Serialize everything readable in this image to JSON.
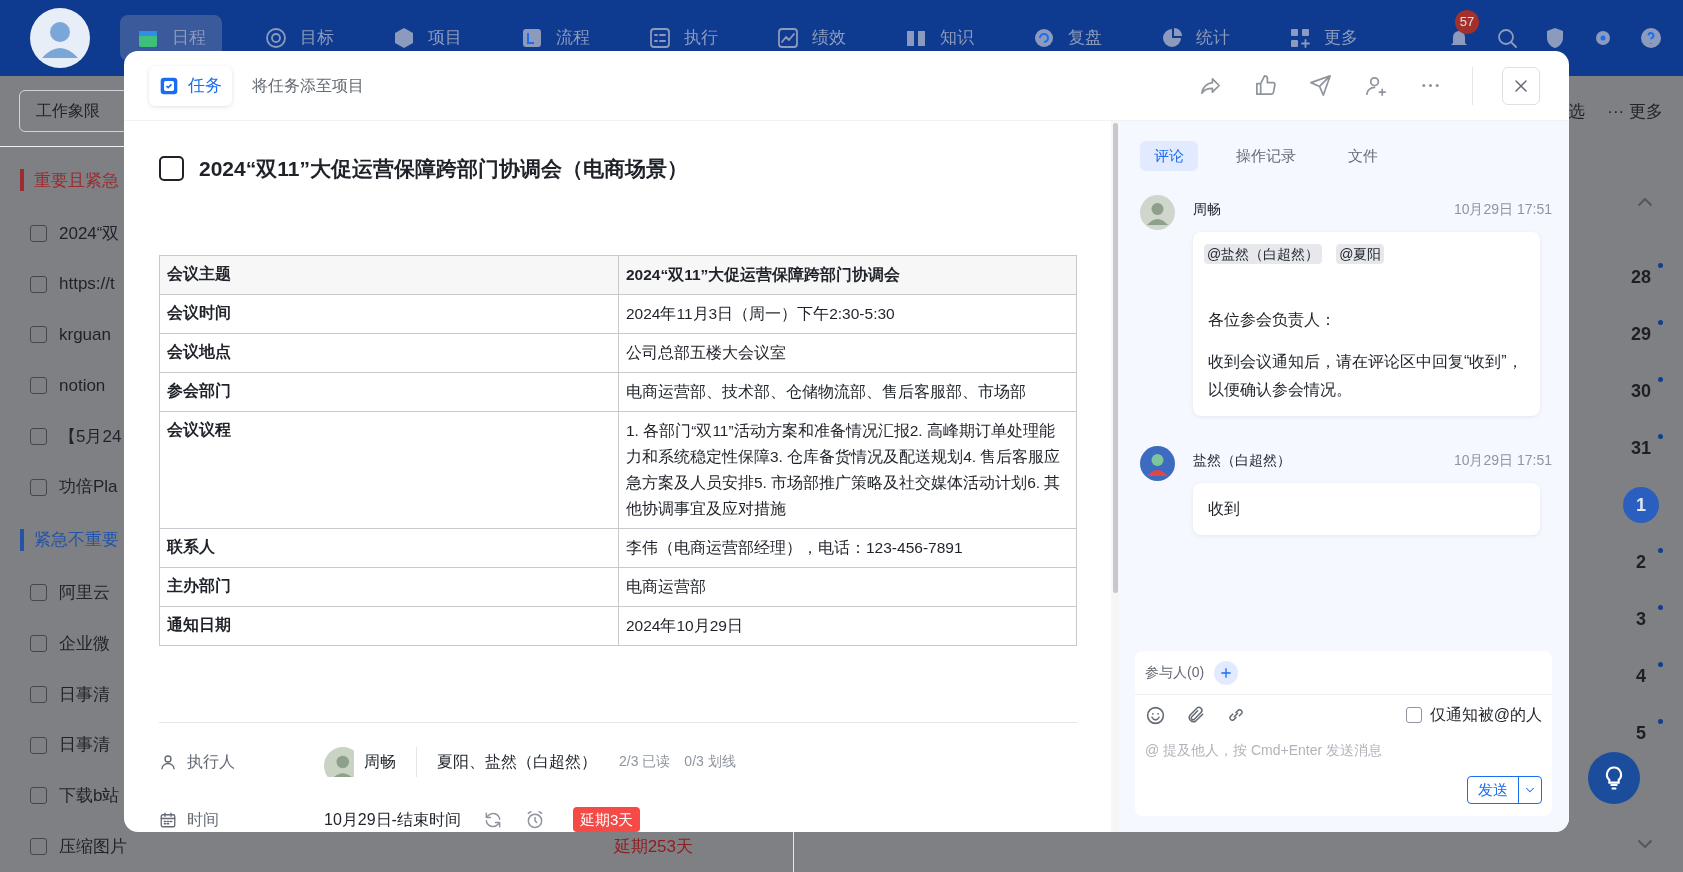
{
  "nav": {
    "items": [
      {
        "label": "日程",
        "selected": true
      },
      {
        "label": "目标",
        "selected": false
      },
      {
        "label": "项目",
        "selected": false
      },
      {
        "label": "流程",
        "selected": false
      },
      {
        "label": "执行",
        "selected": false
      },
      {
        "label": "绩效",
        "selected": false
      },
      {
        "label": "知识",
        "selected": false
      },
      {
        "label": "复盘",
        "selected": false
      },
      {
        "label": "统计",
        "selected": false
      },
      {
        "label": "更多",
        "selected": false
      }
    ],
    "notification_count": "57"
  },
  "toolbar": {
    "view_select": "工作象限",
    "filter_label": "选",
    "more": "··· 更多"
  },
  "quadrants": [
    {
      "title": "重要且紧急",
      "color": "#9b2c31",
      "tasks": [
        {
          "title": "2024“双",
          "checked": false
        },
        {
          "title": "https://t",
          "checked": false
        },
        {
          "title": "krguan",
          "checked": false
        },
        {
          "title": "notion",
          "checked": false
        },
        {
          "title": "【5月24",
          "checked": false
        },
        {
          "title": "功倍Pla",
          "checked": false
        }
      ]
    },
    {
      "title": "紧急不重要",
      "color": "#2453a8",
      "tasks": [
        {
          "title": "阿里云",
          "checked": false
        },
        {
          "title": "企业微",
          "checked": false
        },
        {
          "title": "日事清",
          "checked": false
        },
        {
          "title": "日事清",
          "checked": false
        },
        {
          "title": "下载b站",
          "checked": false
        },
        {
          "title": "压缩图片",
          "checked": false,
          "overdue": "延期253天"
        }
      ]
    }
  ],
  "calendar": {
    "days": [
      {
        "label": "28",
        "dot": true,
        "selected": false
      },
      {
        "label": "29",
        "dot": true,
        "selected": false
      },
      {
        "label": "30",
        "dot": true,
        "selected": false
      },
      {
        "label": "31",
        "dot": true,
        "selected": false
      },
      {
        "label": "1",
        "dot": false,
        "selected": true
      },
      {
        "label": "2",
        "dot": true,
        "selected": false
      },
      {
        "label": "3",
        "dot": true,
        "selected": false
      },
      {
        "label": "4",
        "dot": true,
        "selected": false
      },
      {
        "label": "5",
        "dot": true,
        "selected": false
      }
    ]
  },
  "task_dialog": {
    "type_chip": "任务",
    "add_to_project": "将任务添至项目",
    "title": "2024“双11”大促运营保障跨部门协调会（电商场景）",
    "completed": false,
    "table": {
      "rows": [
        {
          "kind": "header",
          "label": "会议主题",
          "value": "2024“双11”大促运营保障跨部门协调会"
        },
        {
          "kind": "data",
          "label": "会议时间",
          "value": "2024年11月3日（周一）下午2:30-5:30"
        },
        {
          "kind": "data",
          "label": "会议地点",
          "value": "公司总部五楼大会议室"
        },
        {
          "kind": "data",
          "label": "参会部门",
          "value": "电商运营部、技术部、仓储物流部、售后客服部、市场部"
        },
        {
          "kind": "data",
          "label": "会议议程",
          "value": "1. 各部门“双11”活动方案和准备情况汇报2. 高峰期订单处理能力和系统稳定性保障3. 仓库备货情况及配送规划4. 售后客服应急方案及人员安排5. 市场部推广策略及社交媒体活动计划6. 其他协调事宜及应对措施"
        },
        {
          "kind": "data",
          "label": "联系人",
          "value": "李伟（电商运营部经理），电话：123-456-7891"
        },
        {
          "kind": "data",
          "label": "主办部门",
          "value": "电商运营部"
        },
        {
          "kind": "data",
          "label": "通知日期",
          "value": "2024年10月29日"
        }
      ]
    },
    "executor": {
      "label": "执行人",
      "owner": "周畅",
      "members": "夏阳、盐然（白超然）",
      "read": "2/3 已读",
      "underlined": "0/3 划线"
    },
    "time": {
      "label": "时间",
      "value": "10月29日-结束时间",
      "overdue": "延期3天"
    },
    "side_tabs": [
      {
        "label": "评论",
        "selected": true
      },
      {
        "label": "操作记录",
        "selected": false
      },
      {
        "label": "文件",
        "selected": false
      }
    ],
    "comments": [
      {
        "author": "周畅",
        "time": "10月29日 17:51",
        "mentions": [
          "@盐然（白超然）",
          "@夏阳"
        ],
        "paragraphs": [
          "各位参会负责人：",
          "收到会议通知后，请在评论区中回复“收到”，以便确认参会情况。"
        ]
      },
      {
        "author": "盐然（白超然）",
        "time": "10月29日 17:51",
        "paragraphs": [
          "收到"
        ]
      }
    ],
    "composer": {
      "participants": "参与人(0)",
      "notify_only_mentioned": {
        "label": "仅通知被@的人",
        "checked": false
      },
      "placeholder": "@ 提及他人，按 Cmd+Enter 发送消息",
      "send": "发送"
    }
  }
}
